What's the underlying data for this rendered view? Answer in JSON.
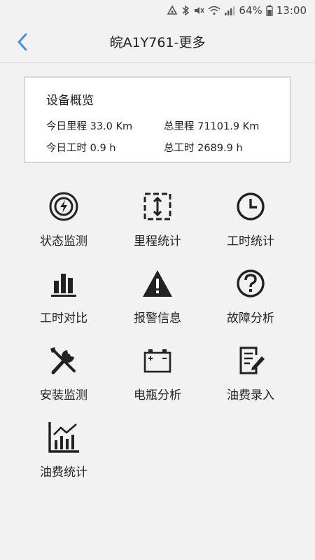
{
  "status_bar": {
    "battery": "64%",
    "time": "13:00"
  },
  "header": {
    "title": "皖A1Y761-更多"
  },
  "overview": {
    "title": "设备概览",
    "today_mileage": "今日里程 33.0 Km",
    "total_mileage": "总里程 71101.9 Km",
    "today_hours": "今日工时 0.9 h",
    "total_hours": "总工时 2689.9 h"
  },
  "menu": [
    {
      "label": "状态监测",
      "icon": "status-monitor-icon"
    },
    {
      "label": "里程统计",
      "icon": "mileage-icon"
    },
    {
      "label": "工时统计",
      "icon": "clock-icon"
    },
    {
      "label": "工时对比",
      "icon": "bar-chart-icon"
    },
    {
      "label": "报警信息",
      "icon": "warning-icon"
    },
    {
      "label": "故障分析",
      "icon": "question-icon"
    },
    {
      "label": "安装监测",
      "icon": "tools-icon"
    },
    {
      "label": "电瓶分析",
      "icon": "battery-icon"
    },
    {
      "label": "油费录入",
      "icon": "edit-document-icon"
    },
    {
      "label": "油费统计",
      "icon": "chart-stats-icon"
    }
  ],
  "colors": {
    "accent": "#3d8fe0",
    "icon": "#222222"
  }
}
